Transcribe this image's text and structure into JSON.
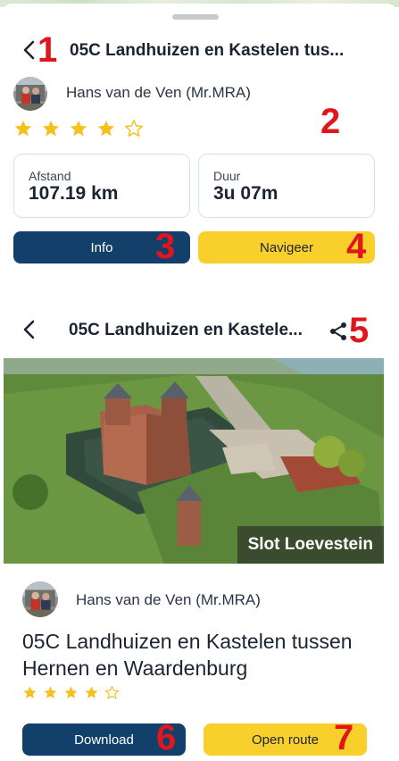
{
  "header": {
    "title": "05C Landhuizen en Kastelen tus..."
  },
  "author": {
    "name": "Hans van de Ven (Mr.MRA)"
  },
  "rating": {
    "value": 4,
    "max": 5
  },
  "stats": [
    {
      "label": "Afstand",
      "value": "107.19 km"
    },
    {
      "label": "Duur",
      "value": "3u 07m"
    }
  ],
  "actions": {
    "info_label": "Info",
    "navigate_label": "Navigeer"
  },
  "detail": {
    "title": "05C Landhuizen en Kastele...",
    "image_caption": "Slot Loevestein",
    "author_name": "Hans van de Ven (Mr.MRA)",
    "route_name": "05C Landhuizen en Kastelen tussen Hernen en Waardenburg",
    "rating": 4,
    "download_label": "Download",
    "open_route_label": "Open route"
  },
  "markers": [
    "1",
    "2",
    "3",
    "4",
    "5",
    "6",
    "7"
  ],
  "colors": {
    "primary_dark": "#12406b",
    "accent_yellow": "#f9cf2c",
    "star": "#f6c01e",
    "card_border": "#cfe3f7",
    "annotation_red": "#e0161b"
  },
  "icons": [
    "chevron-left-icon",
    "star-icon",
    "share-icon"
  ]
}
